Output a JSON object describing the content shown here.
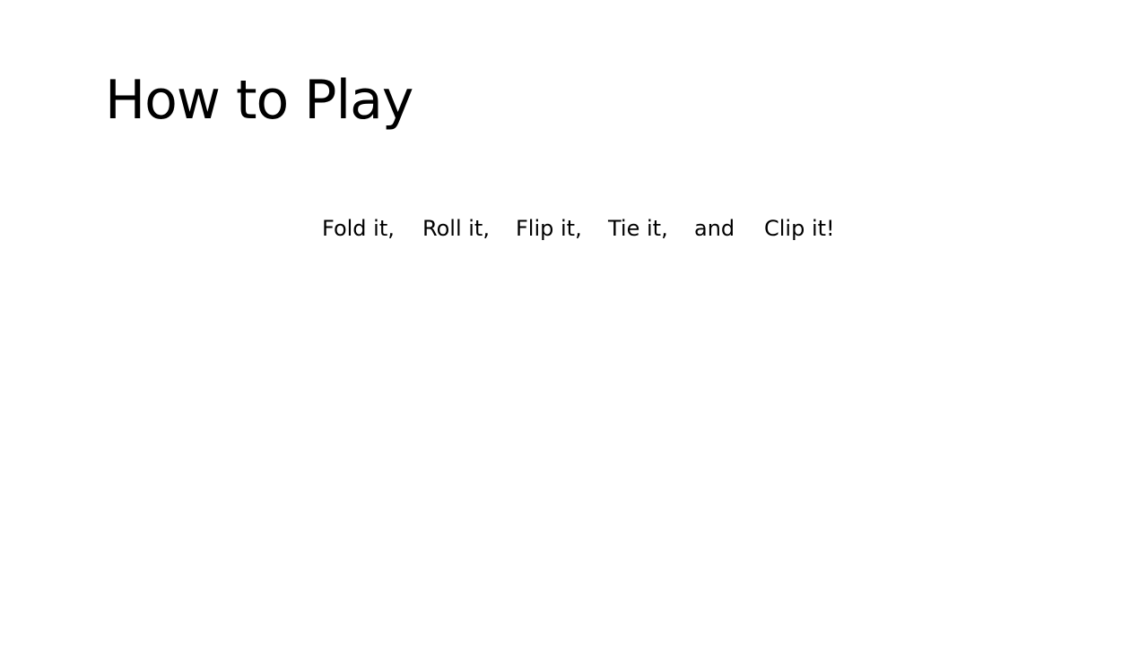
{
  "slide": {
    "title": "How to Play",
    "steps": [
      "Fold it,",
      "Roll it,",
      "Flip it,",
      "Tie it,",
      "and",
      "Clip it!"
    ]
  }
}
